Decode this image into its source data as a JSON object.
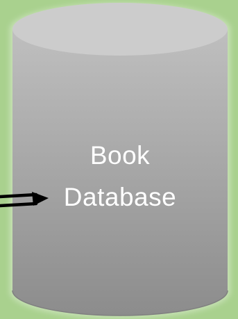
{
  "background_color": "#a9d18e",
  "database": {
    "label_line_1": "Book",
    "label_line_2": "Database",
    "body_color": "#a6a6a6",
    "top_color": "#cccccc",
    "text_color": "#ffffff"
  },
  "arrow": {
    "color": "#000000",
    "icon": "arrow-right-icon"
  }
}
